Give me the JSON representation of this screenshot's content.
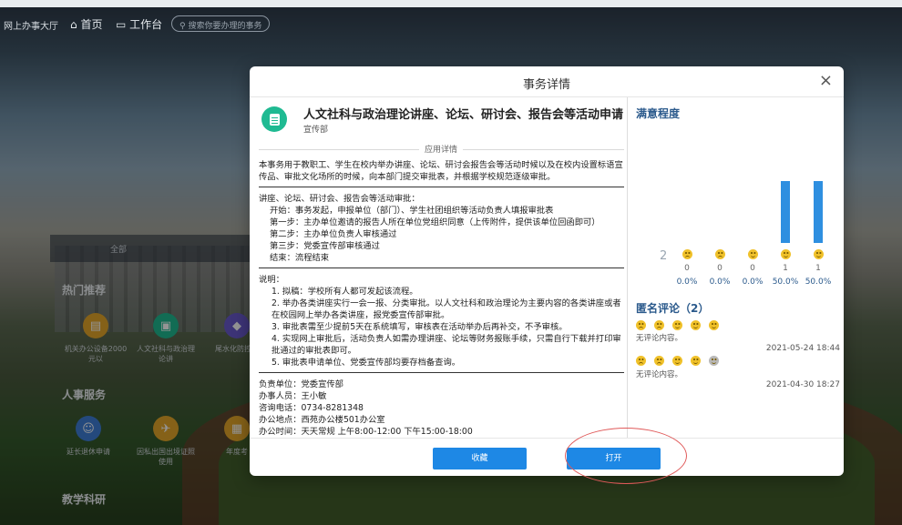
{
  "background": {
    "site_title": "网上办事大厅",
    "nav": {
      "home_label": "首页",
      "work_label": "工作台",
      "search_placeholder": "搜索你要办理的事务"
    },
    "category_tab": "全部",
    "sections": [
      {
        "title": "热门推荐",
        "apps": [
          "机关办公设备2000元以",
          "人文社科与政治理论讲",
          "尾水化防控防"
        ]
      },
      {
        "title": "人事服务",
        "apps": [
          "延长退休申请",
          "因私出国出境证照使用",
          "年度考"
        ]
      },
      {
        "title": "教学科研",
        "apps": []
      }
    ]
  },
  "modal": {
    "title": "事务详情",
    "close_label": "×",
    "app_name": "人文社科与政治理论讲座、论坛、研讨会、报告会等活动申请",
    "department": "宣传部",
    "section_label": "应用详情",
    "intro": "本事务用于教职工、学生在校内举办讲座、论坛、研讨会报告会等活动时候以及在校内设置标语宣传品、审批文化场所的时候，向本部门提交审批表，并根据学校规范逐级审批。",
    "process": {
      "heading": "讲座、论坛、研讨会、报告会等活动审批：",
      "steps": [
        "开始：事务发起，申报单位（部门）、学生社团组织等活动负责人填报审批表",
        "第一步：主办单位邀请的报告人所在单位党组织同意（上传附件，提供该单位回函即可）",
        "第二步：主办单位负责人审核通过",
        "第三步：党委宣传部审核通过",
        "结束：流程结束"
      ]
    },
    "notes": {
      "heading": "说明：",
      "items": [
        "1. 拟稿：学校所有人都可发起该流程。",
        "2. 举办各类讲座实行一会一报、分类审批。以人文社科和政治理论为主要内容的各类讲座或者在校园网上举办各类讲座，报党委宣传部审批。",
        "3. 审批表需至少提前5天在系统填写，审核表在活动举办后再补交，不予审核。",
        "4. 实现网上审批后，活动负责人如需办理讲座、论坛等财务报账手续，只需自行下载并打印审批通过的审批表即可。",
        "5. 审批表申请单位、党委宣传部均要存档备查询。"
      ]
    },
    "contact": {
      "unit": "负责单位：党委宣传部",
      "handler": "办事人员：王小敏",
      "phone": "咨询电话：0734-8281348",
      "location": "办公地点：西苑办公楼501办公室",
      "hours": "办公时间：天天常规 上午8:00-12:00 下午15:00-18:00"
    },
    "buttons": {
      "favorite": "收藏",
      "open": "打开"
    },
    "satisfaction": {
      "title": "满意程度",
      "total": "2",
      "levels": [
        {
          "icon": "very-unsatisfied-face-icon",
          "count": "0",
          "percent": "0.0%",
          "ratio": 0.0
        },
        {
          "icon": "unsatisfied-face-icon",
          "count": "0",
          "percent": "0.0%",
          "ratio": 0.0
        },
        {
          "icon": "neutral-face-icon",
          "count": "0",
          "percent": "0.0%",
          "ratio": 0.0
        },
        {
          "icon": "satisfied-face-icon",
          "count": "1",
          "percent": "50.0%",
          "ratio": 0.5
        },
        {
          "icon": "very-satisfied-face-icon",
          "count": "1",
          "percent": "50.0%",
          "ratio": 0.5
        }
      ],
      "bar_color": "#2e8fe0"
    },
    "anonymous": {
      "title": "匿名评论（2）",
      "comments": [
        {
          "text": "无评论内容。",
          "date": "2021-05-24 18:44"
        },
        {
          "text": "无评论内容。",
          "date": "2021-04-30 18:27"
        }
      ]
    }
  },
  "colors": {
    "accent": "#1e88e5",
    "app_icon": "#1fba92",
    "heading_blue": "#2b5a8c",
    "annotation": "#e05a5a"
  }
}
